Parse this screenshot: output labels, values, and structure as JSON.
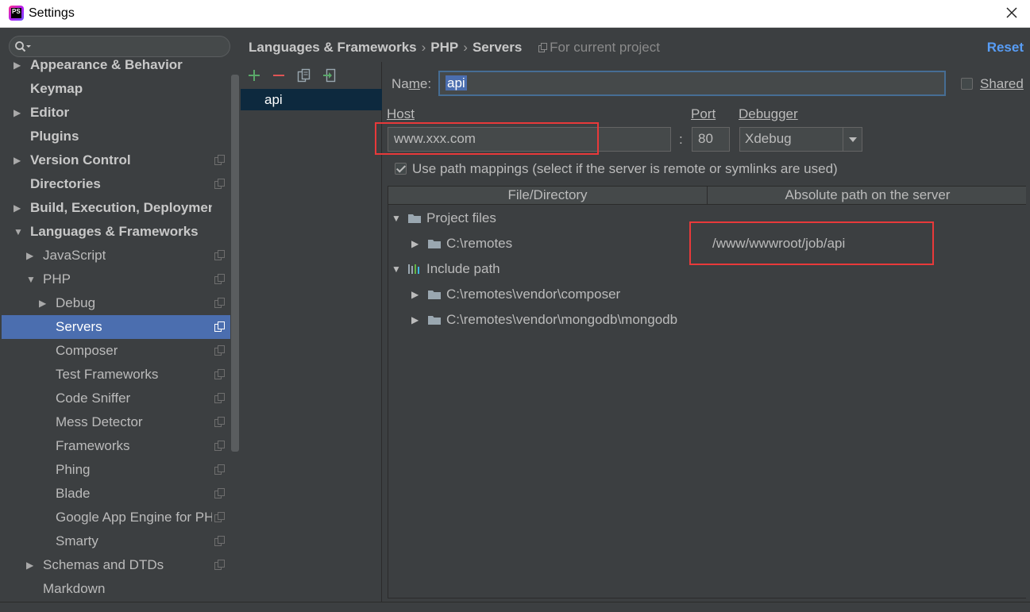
{
  "window": {
    "title": "Settings",
    "app_icon_text": "PS"
  },
  "search": {
    "placeholder": ""
  },
  "tree": [
    {
      "label": "Appearance & Behavior",
      "level": 0,
      "arrow": "collapsed",
      "bold": true,
      "proj": false
    },
    {
      "label": "Keymap",
      "level": 0,
      "arrow": "none",
      "bold": true,
      "proj": false
    },
    {
      "label": "Editor",
      "level": 0,
      "arrow": "collapsed",
      "bold": true,
      "proj": false
    },
    {
      "label": "Plugins",
      "level": 0,
      "arrow": "none",
      "bold": true,
      "proj": false
    },
    {
      "label": "Version Control",
      "level": 0,
      "arrow": "collapsed",
      "bold": true,
      "proj": true
    },
    {
      "label": "Directories",
      "level": 0,
      "arrow": "none",
      "bold": true,
      "proj": true
    },
    {
      "label": "Build, Execution, Deployment",
      "level": 0,
      "arrow": "collapsed",
      "bold": true,
      "proj": false
    },
    {
      "label": "Languages & Frameworks",
      "level": 0,
      "arrow": "expanded",
      "bold": true,
      "proj": false
    },
    {
      "label": "JavaScript",
      "level": 1,
      "arrow": "collapsed",
      "bold": false,
      "proj": true
    },
    {
      "label": "PHP",
      "level": 1,
      "arrow": "expanded",
      "bold": false,
      "proj": true
    },
    {
      "label": "Debug",
      "level": 2,
      "arrow": "collapsed",
      "bold": false,
      "proj": true
    },
    {
      "label": "Servers",
      "level": 2,
      "arrow": "none",
      "bold": false,
      "proj": true,
      "selected": true
    },
    {
      "label": "Composer",
      "level": 2,
      "arrow": "none",
      "bold": false,
      "proj": true
    },
    {
      "label": "Test Frameworks",
      "level": 2,
      "arrow": "none",
      "bold": false,
      "proj": true
    },
    {
      "label": "Code Sniffer",
      "level": 2,
      "arrow": "none",
      "bold": false,
      "proj": true
    },
    {
      "label": "Mess Detector",
      "level": 2,
      "arrow": "none",
      "bold": false,
      "proj": true
    },
    {
      "label": "Frameworks",
      "level": 2,
      "arrow": "none",
      "bold": false,
      "proj": true
    },
    {
      "label": "Phing",
      "level": 2,
      "arrow": "none",
      "bold": false,
      "proj": true
    },
    {
      "label": "Blade",
      "level": 2,
      "arrow": "none",
      "bold": false,
      "proj": true
    },
    {
      "label": "Google App Engine for PHP",
      "level": 2,
      "arrow": "none",
      "bold": false,
      "proj": true
    },
    {
      "label": "Smarty",
      "level": 2,
      "arrow": "none",
      "bold": false,
      "proj": true
    },
    {
      "label": "Schemas and DTDs",
      "level": 1,
      "arrow": "collapsed",
      "bold": false,
      "proj": true
    },
    {
      "label": "Markdown",
      "level": 1,
      "arrow": "none",
      "bold": false,
      "proj": false
    }
  ],
  "breadcrumb": {
    "items": [
      "Languages & Frameworks",
      "PHP",
      "Servers"
    ],
    "separator": "›",
    "scope": "For current project"
  },
  "reset_label": "Reset",
  "servers": {
    "items": [
      "api"
    ]
  },
  "form": {
    "name_label_pre": "Na",
    "name_label_u": "m",
    "name_label_post": "e:",
    "name_value": "api",
    "shared_label": "Shared",
    "host_label": "Host",
    "host_value": "www.xxx.com",
    "colon": ":",
    "port_label": "Port",
    "port_value": "80",
    "debugger_label": "Debugger",
    "debugger_value": "Xdebug",
    "use_mappings_label": "Use path mappings (select if the server is remote or symlinks are used)",
    "use_mappings_checked": true
  },
  "mapping_table": {
    "columns": [
      "File/Directory",
      "Absolute path on the server"
    ],
    "rows": [
      {
        "text": "Project files",
        "level": 0,
        "arrow": "expanded",
        "icon": "folder-icon",
        "path": ""
      },
      {
        "text": "C:\\remotes",
        "level": 1,
        "arrow": "collapsed",
        "icon": "folder-icon",
        "path": "/www/wwwroot/job/api"
      },
      {
        "text": "Include path",
        "level": 0,
        "arrow": "expanded",
        "icon": "library-icon",
        "path": ""
      },
      {
        "text": "C:\\remotes\\vendor\\composer",
        "level": 1,
        "arrow": "collapsed",
        "icon": "folder-icon",
        "path": ""
      },
      {
        "text": "C:\\remotes\\vendor\\mongodb\\mongodb",
        "level": 1,
        "arrow": "collapsed",
        "icon": "folder-icon",
        "path": ""
      }
    ]
  },
  "colors": {
    "background": "#3c3f41",
    "selection": "#4b6eaf",
    "accent_link": "#589df6",
    "highlight_box": "#e8393a",
    "add_button": "#59a869",
    "remove_button": "#e05555"
  }
}
